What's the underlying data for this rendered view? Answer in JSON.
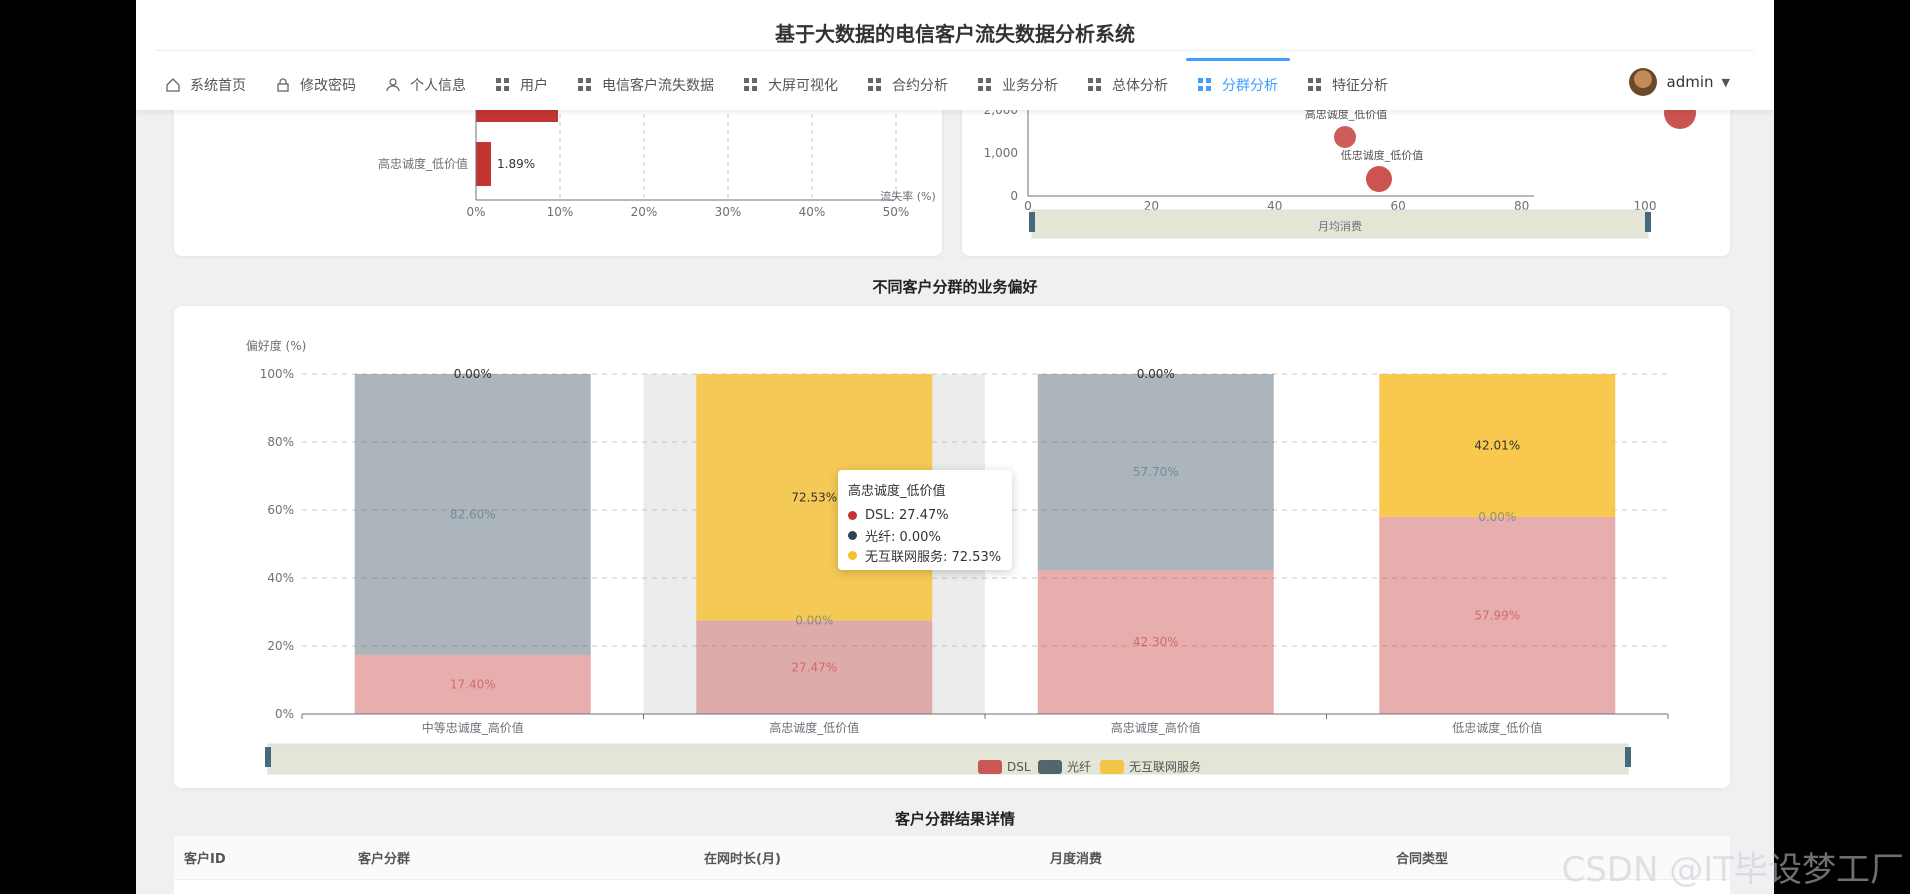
{
  "header": {
    "title": "基于大数据的电信客户流失数据分析系统",
    "nav": [
      {
        "label": "系统首页",
        "icon": "home-icon",
        "active": false
      },
      {
        "label": "修改密码",
        "icon": "lock-icon",
        "active": false
      },
      {
        "label": "个人信息",
        "icon": "user-icon",
        "active": false
      },
      {
        "label": "用户",
        "icon": "grid-icon",
        "active": false
      },
      {
        "label": "电信客户流失数据",
        "icon": "grid-icon",
        "active": false
      },
      {
        "label": "大屏可视化",
        "icon": "grid-icon",
        "active": false
      },
      {
        "label": "合约分析",
        "icon": "grid-icon",
        "active": false
      },
      {
        "label": "业务分析",
        "icon": "grid-icon",
        "active": false
      },
      {
        "label": "总体分析",
        "icon": "grid-icon",
        "active": false
      },
      {
        "label": "分群分析",
        "icon": "grid-icon",
        "active": true
      },
      {
        "label": "特征分析",
        "icon": "grid-icon",
        "active": false
      }
    ],
    "user": "admin"
  },
  "churn_chart": {
    "bar_label": "高忠诚度_低价值",
    "bar_value_label": "1.89%",
    "axis_name": "流失率 (%)",
    "ticks": [
      "0%",
      "10%",
      "20%",
      "30%",
      "40%",
      "50%"
    ]
  },
  "scatter_chart": {
    "y_ticks": [
      "2,000",
      "1,000",
      "0"
    ],
    "x_ticks": [
      "0",
      "20",
      "40",
      "60",
      "80",
      "100"
    ],
    "x_name": "月均消费",
    "point_labels": [
      "高忠诚度_低价值",
      "低忠诚度_低价值"
    ]
  },
  "preference": {
    "title": "不同客户分群的业务偏好",
    "y_name": "偏好度 (%)",
    "y_ticks": [
      "100%",
      "80%",
      "60%",
      "40%",
      "20%",
      "0%"
    ],
    "legend": [
      "DSL",
      "光纤",
      "无互联网服务"
    ],
    "colors": {
      "dsl": "#c23531",
      "fiber": "#2f4554",
      "none": "#f7c02f"
    },
    "tooltip": {
      "title": "高忠诚度_低价值",
      "rows": [
        "DSL: 27.47%",
        "光纤: 0.00%",
        "无互联网服务: 72.53%"
      ]
    }
  },
  "chart_data": {
    "type": "bar",
    "title": "不同客户分群的业务偏好",
    "ylabel": "偏好度 (%)",
    "ylim": [
      0,
      100
    ],
    "stacked": true,
    "categories": [
      "中等忠诚度_高价值",
      "高忠诚度_低价值",
      "高忠诚度_高价值",
      "低忠诚度_低价值"
    ],
    "series": [
      {
        "name": "DSL",
        "values": [
          17.4,
          27.47,
          42.3,
          57.99
        ],
        "labels": [
          "17.40%",
          "27.47%",
          "42.30%",
          "57.99%"
        ]
      },
      {
        "name": "光纤",
        "values": [
          82.6,
          0.0,
          57.7,
          0.0
        ],
        "labels": [
          "82.60%",
          "0.00%",
          "57.70%",
          "0.00%"
        ]
      },
      {
        "name": "无互联网服务",
        "values": [
          0.0,
          72.53,
          0.0,
          42.01
        ],
        "labels": [
          "0.00%",
          "72.53%",
          "0.00%",
          "42.01%"
        ]
      }
    ]
  },
  "table": {
    "title": "客户分群结果详情",
    "columns": [
      "客户ID",
      "客户分群",
      "在网时长(月)",
      "月度消费",
      "合同类型"
    ]
  },
  "watermark": "CSDN @IT毕设梦工厂"
}
